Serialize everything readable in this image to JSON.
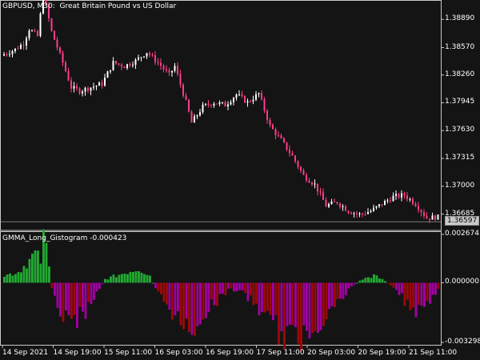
{
  "window": {
    "symbol_label": "GBPUSD, M30:",
    "description": "Great Britain Pound vs US Dollar"
  },
  "indicator": {
    "name": "GMMA_Long_Gistogram",
    "value": "-0.000423"
  },
  "colors": {
    "background": "#141414",
    "frame": "#c8c8c8",
    "bull_candle": "#ffffff",
    "bear_candle": "#ff3c8c",
    "hist_positive": "#22a832",
    "hist_negative_dark": "#9a0a0a",
    "hist_negative_light": "#a000a0",
    "price_line": "#7a7a7a"
  },
  "price_axis": {
    "labels": [
      "1.38890",
      "1.38570",
      "1.38260",
      "1.37945",
      "1.37630",
      "1.37315",
      "1.37000",
      "1.36685"
    ],
    "current_price": "1.36597"
  },
  "indicator_axis": {
    "labels": [
      "0.002674",
      "0.000000",
      "-0.003298"
    ]
  },
  "time_axis": {
    "labels": [
      "14 Sep 2021",
      "14 Sep 19:00",
      "15 Sep 11:00",
      "16 Sep 03:00",
      "16 Sep 19:00",
      "17 Sep 11:00",
      "20 Sep 03:00",
      "20 Sep 19:00",
      "21 Sep 11:00"
    ]
  },
  "chart_data": [
    {
      "type": "candlestick",
      "title": "GBPUSD, M30:  Great Britain Pound vs US Dollar",
      "ylim": [
        1.365,
        1.391
      ],
      "price_anchors": [
        [
          0,
          1.3848
        ],
        [
          5,
          1.3855
        ],
        [
          8,
          1.3862
        ],
        [
          10,
          1.3878
        ],
        [
          13,
          1.387
        ],
        [
          15,
          1.3918
        ],
        [
          18,
          1.3875
        ],
        [
          22,
          1.384
        ],
        [
          25,
          1.3812
        ],
        [
          28,
          1.3808
        ],
        [
          32,
          1.3812
        ],
        [
          36,
          1.3816
        ],
        [
          40,
          1.384
        ],
        [
          44,
          1.3836
        ],
        [
          48,
          1.3842
        ],
        [
          52,
          1.3852
        ],
        [
          56,
          1.384
        ],
        [
          60,
          1.3826
        ],
        [
          62,
          1.3836
        ],
        [
          66,
          1.3795
        ],
        [
          68,
          1.3772
        ],
        [
          72,
          1.379
        ],
        [
          76,
          1.3795
        ],
        [
          80,
          1.3792
        ],
        [
          84,
          1.3804
        ],
        [
          88,
          1.3795
        ],
        [
          92,
          1.3805
        ],
        [
          96,
          1.3768
        ],
        [
          100,
          1.3752
        ],
        [
          104,
          1.3734
        ],
        [
          108,
          1.3712
        ],
        [
          112,
          1.3702
        ],
        [
          116,
          1.3678
        ],
        [
          120,
          1.3682
        ],
        [
          124,
          1.3672
        ],
        [
          128,
          1.3668
        ],
        [
          132,
          1.3672
        ],
        [
          136,
          1.368
        ],
        [
          140,
          1.3688
        ],
        [
          144,
          1.369
        ],
        [
          148,
          1.368
        ],
        [
          152,
          1.3664
        ],
        [
          155,
          1.3665
        ]
      ],
      "candle_count": 156
    },
    {
      "type": "bar",
      "title": "GMMA_Long_Gistogram -0.000423",
      "ylim": [
        -0.003298,
        0.002674
      ],
      "value_anchors": [
        [
          0,
          0.0004
        ],
        [
          5,
          0.0006
        ],
        [
          8,
          0.0011
        ],
        [
          11,
          0.0016
        ],
        [
          13,
          0.0012
        ],
        [
          14,
          0.0024
        ],
        [
          15,
          0.002
        ],
        [
          17,
          -0.0004
        ],
        [
          20,
          -0.0016
        ],
        [
          24,
          -0.0022
        ],
        [
          28,
          -0.0018
        ],
        [
          32,
          -0.0008
        ],
        [
          36,
          0.0002
        ],
        [
          40,
          0.0004
        ],
        [
          44,
          0.0006
        ],
        [
          48,
          0.0008
        ],
        [
          52,
          0.0004
        ],
        [
          54,
          -0.0004
        ],
        [
          58,
          -0.0012
        ],
        [
          62,
          -0.002
        ],
        [
          64,
          -0.0026
        ],
        [
          68,
          -0.0024
        ],
        [
          72,
          -0.0016
        ],
        [
          76,
          -0.001
        ],
        [
          80,
          -0.0004
        ],
        [
          84,
          -0.0004
        ],
        [
          88,
          -0.001
        ],
        [
          92,
          -0.0016
        ],
        [
          96,
          -0.0024
        ],
        [
          100,
          -0.003
        ],
        [
          104,
          -0.0032
        ],
        [
          108,
          -0.0028
        ],
        [
          112,
          -0.0022
        ],
        [
          116,
          -0.0016
        ],
        [
          120,
          -0.001
        ],
        [
          124,
          -0.0002
        ],
        [
          128,
          0.0002
        ],
        [
          132,
          0.0004
        ],
        [
          136,
          0.0001
        ],
        [
          140,
          -0.0004
        ],
        [
          144,
          -0.0012
        ],
        [
          148,
          -0.0016
        ],
        [
          152,
          -0.001
        ],
        [
          155,
          -0.0004
        ]
      ],
      "bar_count": 156
    }
  ]
}
